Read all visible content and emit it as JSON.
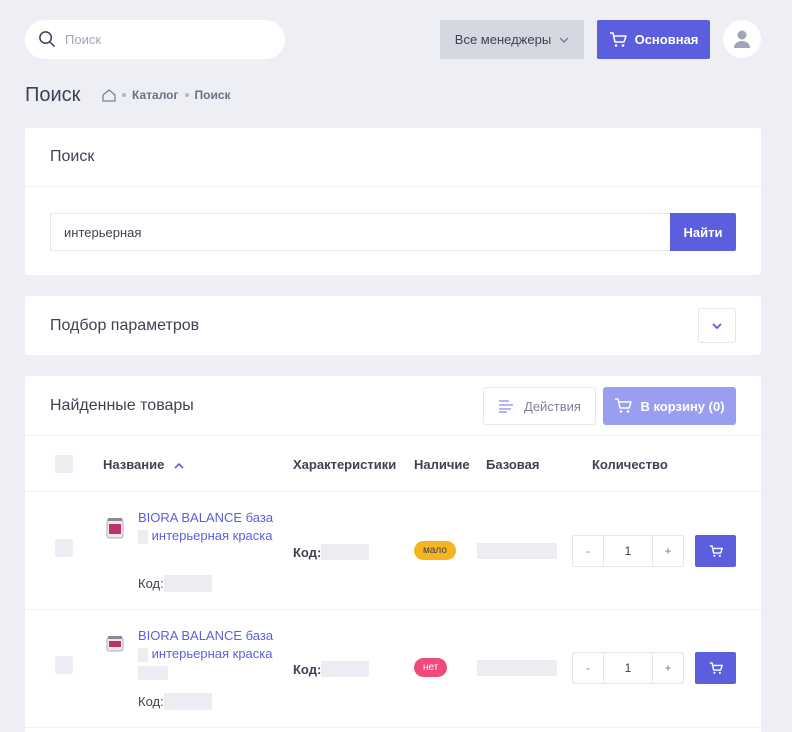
{
  "header": {
    "search_placeholder": "Поиск",
    "managers_label": "Все менеджеры",
    "main_cart_label": "Основная"
  },
  "page": {
    "title": "Поиск",
    "breadcrumb": [
      "Каталог",
      "Поиск"
    ]
  },
  "search_card": {
    "title": "Поиск",
    "query": "интерьерная",
    "find_label": "Найти"
  },
  "params_card": {
    "title": "Подбор параметров"
  },
  "results": {
    "title": "Найденные товары",
    "actions_label": "Действия",
    "to_cart_label": "В корзину (0)",
    "columns": [
      "Название",
      "Характеристики",
      "Наличие",
      "Базовая",
      "Количество"
    ],
    "code_label": "Код:",
    "rows": [
      {
        "name_line1": "BIORA BALANCE база",
        "name_line2": "интерьерная краска",
        "stock": "мало",
        "quantity": "1"
      },
      {
        "name_line1": "BIORA BALANCE база",
        "name_line2": "интерьерная краска",
        "stock": "нет",
        "quantity": "1"
      }
    ],
    "minus": "-",
    "plus": "+"
  },
  "colors": {
    "accent": "#5b5fde",
    "accent_light": "#9a9ef0",
    "stock_low": "#f6b420",
    "stock_none": "#ef4a7a",
    "background": "#eeeef5"
  }
}
